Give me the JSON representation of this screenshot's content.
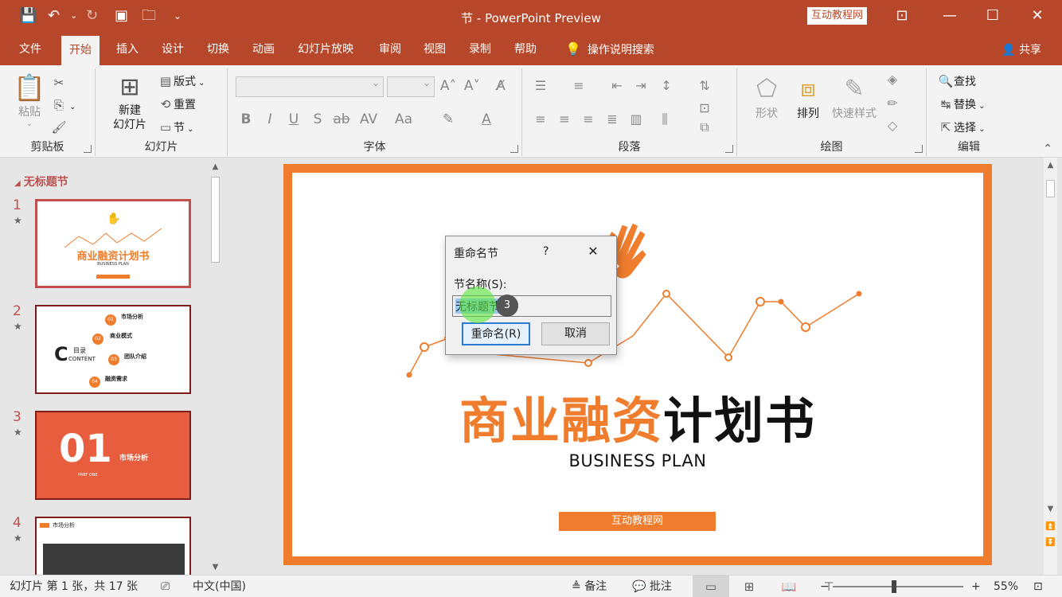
{
  "app": {
    "title": "节  -  PowerPoint Preview",
    "brand": "互动教程网"
  },
  "tabs": [
    "文件",
    "开始",
    "插入",
    "设计",
    "切换",
    "动画",
    "幻灯片放映",
    "审阅",
    "视图",
    "录制",
    "帮助"
  ],
  "search_label": "操作说明搜索",
  "share_label": "共享",
  "ribbon": {
    "clipboard": {
      "label": "剪贴板",
      "paste": "粘贴"
    },
    "slides": {
      "label": "幻灯片",
      "new_slide_1": "新建",
      "new_slide_2": "幻灯片",
      "layout": "版式",
      "reset": "重置",
      "section": "节"
    },
    "font": {
      "label": "字体"
    },
    "paragraph": {
      "label": "段落"
    },
    "drawing": {
      "label": "绘图",
      "shapes": "形状",
      "arrange": "排列",
      "quick_styles": "快速样式"
    },
    "editing": {
      "label": "编辑",
      "find": "查找",
      "replace": "替换",
      "select": "选择"
    }
  },
  "thumbnails": {
    "section_name": "无标题节",
    "slides": [
      {
        "num": "1",
        "title": "商业融资计划书",
        "sub": "BUSINESS PLAN"
      },
      {
        "num": "2",
        "items": [
          "市场分析",
          "商业模式",
          "团队介绍",
          "融资需求"
        ],
        "heading": "目录",
        "content": "CONTENT"
      },
      {
        "num": "3",
        "big": "01",
        "title": "市场分析",
        "sub": "PART ONE"
      },
      {
        "num": "4",
        "title": "市场分析"
      }
    ]
  },
  "slide": {
    "title_orange": "商业融资",
    "title_black": "计划书",
    "subtitle": "BUSINESS PLAN",
    "button": "互动教程网"
  },
  "dialog": {
    "title": "重命名节",
    "help": "?",
    "label": "节名称(S):",
    "value": "无标题节",
    "rename": "重命名(R)",
    "cancel": "取消",
    "click_count": "3"
  },
  "status": {
    "slide_info": "幻灯片 第 1 张，共 17 张",
    "language": "中文(中国)",
    "notes": "备注",
    "comments": "批注",
    "zoom": "55%"
  },
  "colors": {
    "accent": "#b7472a",
    "slide_orange": "#ef7d2d"
  }
}
